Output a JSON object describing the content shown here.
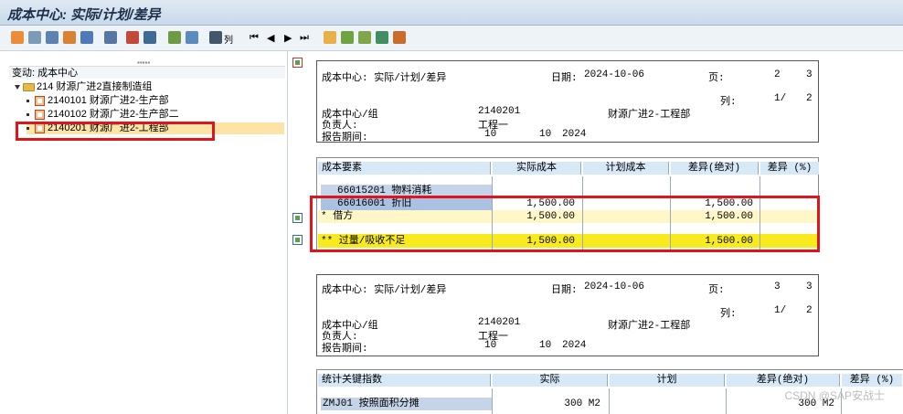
{
  "title": "成本中心: 实际/计划/差异",
  "toolbar": {
    "column_label": "列"
  },
  "tree": {
    "header": "变动:  成本中心",
    "root": "214 财源广进2直接制造组",
    "children": [
      {
        "label": "2140101 财源广进2-生产部"
      },
      {
        "label": "2140102 财源广进2-生产部二"
      },
      {
        "label": "2140201 财源广进2-工程部"
      }
    ]
  },
  "report1": {
    "header": {
      "title": "成本中心: 实际/计划/差异",
      "date_label": "日期:",
      "date": "2024-10-06",
      "page_label": "页:",
      "page": "2",
      "pages": "3",
      "col_label": "列:",
      "col": "1/",
      "cols": "2",
      "cc_label": "成本中心/组",
      "cc_value": "2140201",
      "cc_name": "财源广进2-工程部",
      "resp_label": "负责人:",
      "resp_value": "工程一",
      "period_label": "报告期间:",
      "period_from": "10",
      "period_to": "10",
      "year": "2024"
    },
    "table": {
      "columns": [
        "成本要素",
        "实际成本",
        "计划成本",
        "差异(绝对)",
        "差异 (%)"
      ],
      "rows": [
        {
          "element": "66015201  物料消耗",
          "actual": "",
          "plan": "",
          "var_abs": "",
          "var_pct": ""
        },
        {
          "element": "66016001  折旧",
          "actual": "1,500.00",
          "plan": "",
          "var_abs": "1,500.00",
          "var_pct": ""
        },
        {
          "element": "*  借方",
          "actual": "1,500.00",
          "plan": "",
          "var_abs": "1,500.00",
          "var_pct": ""
        },
        {
          "element": "** 过量/吸收不足",
          "actual": "1,500.00",
          "plan": "",
          "var_abs": "1,500.00",
          "var_pct": ""
        }
      ]
    }
  },
  "report2": {
    "header": {
      "title": "成本中心: 实际/计划/差异",
      "date_label": "日期:",
      "date": "2024-10-06",
      "page_label": "页:",
      "page": "3",
      "pages": "3",
      "col_label": "列:",
      "col": "1/",
      "cols": "2",
      "cc_label": "成本中心/组",
      "cc_value": "2140201",
      "cc_name": "财源广进2-工程部",
      "resp_label": "负责人:",
      "resp_value": "工程一",
      "period_label": "报告期间:",
      "period_from": "10",
      "period_to": "10",
      "year": "2024"
    },
    "table": {
      "columns": [
        "统计关键指数",
        "实际",
        "计划",
        "差异(绝对)",
        "差异 (%)"
      ],
      "rows": [
        {
          "element": "ZMJ01  按照面积分摊",
          "actual": "300  M2",
          "plan": "",
          "var_abs": "300  M2",
          "var_pct": ""
        }
      ]
    }
  },
  "watermark": "CSDN @SAP安战士",
  "colors": {
    "highlight_red": "#e0151b",
    "subtotal_yellow": "#fff7c8",
    "total_yellow": "#f7ea1f",
    "header_blue": "#d7e8f7"
  }
}
